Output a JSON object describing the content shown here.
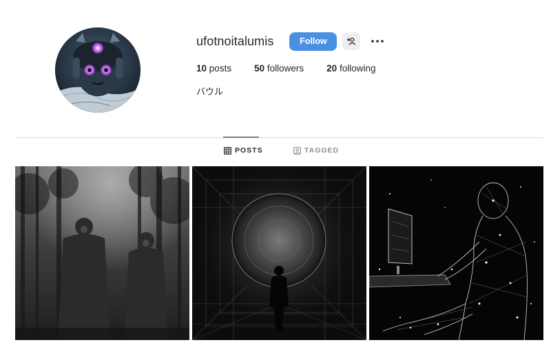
{
  "profile": {
    "username": "ufotnoitalumis",
    "follow_label": "Follow",
    "bio": "バウル"
  },
  "stats": {
    "posts_count": "10",
    "posts_label": "posts",
    "followers_count": "50",
    "followers_label": "followers",
    "following_count": "20",
    "following_label": "following"
  },
  "tabs": [
    {
      "label": "POSTS",
      "icon": "grid-icon",
      "active": true
    },
    {
      "label": "TAGGED",
      "icon": "tag-person-icon",
      "active": false
    }
  ],
  "posts": [
    {
      "subject": "figures-in-gas-masks-forest"
    },
    {
      "subject": "silhouette-before-glowing-sphere"
    },
    {
      "subject": "wireframe-figure-at-computer"
    }
  ],
  "colors": {
    "follow_button": "#4a90e2",
    "text_primary": "#262626",
    "text_secondary": "#8e8e8e",
    "divider": "#dbdbdb"
  }
}
